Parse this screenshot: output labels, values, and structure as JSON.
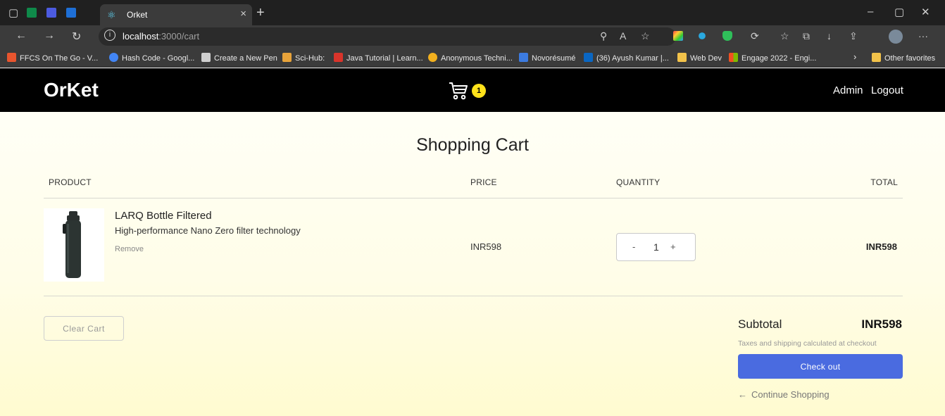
{
  "browser": {
    "tab_title": "Orket",
    "url_host": "localhost",
    "url_path": ":3000/cart",
    "bookmarks": [
      {
        "label": "FFCS On The Go - V...",
        "color": "#e8552e"
      },
      {
        "label": "Hash Code - Googl...",
        "color": "#4285f4"
      },
      {
        "label": "Create a New Pen",
        "color": "#cfcfcf"
      },
      {
        "label": "Sci-Hub:",
        "color": "#e8a33a"
      },
      {
        "label": "Java Tutorial | Learn...",
        "color": "#d9342b"
      },
      {
        "label": "Anonymous Techni...",
        "color": "#f2b01e"
      },
      {
        "label": "Novorésumé",
        "color": "#3c7be0"
      },
      {
        "label": "(36) Ayush Kumar |...",
        "color": "#0a66c2"
      },
      {
        "label": "Web Dev",
        "color": "#f2c24a"
      },
      {
        "label": "Engage 2022 - Engi...",
        "color": "#f25022"
      }
    ],
    "other_favorites": "Other favorites"
  },
  "header": {
    "logo": "OrKet",
    "cart_count": "1",
    "admin": "Admin",
    "logout": "Logout"
  },
  "cart": {
    "title": "Shopping Cart",
    "columns": {
      "product": "PRODUCT",
      "price": "PRICE",
      "quantity": "QUANTITY",
      "total": "TOTAL"
    },
    "items": [
      {
        "name": "LARQ Bottle Filtered",
        "description": "High-performance Nano Zero filter technology",
        "remove": "Remove",
        "price": "INR598",
        "quantity": "1",
        "decrement": "-",
        "increment": "+",
        "total": "INR598"
      }
    ],
    "clear": "Clear Cart",
    "subtotal_label": "Subtotal",
    "subtotal_value": "INR598",
    "tax_note": "Taxes and shipping calculated at checkout",
    "checkout": "Check out",
    "continue": "Continue Shopping"
  },
  "colors": {
    "accent": "#4a6be0",
    "badge": "#ffe21a"
  }
}
